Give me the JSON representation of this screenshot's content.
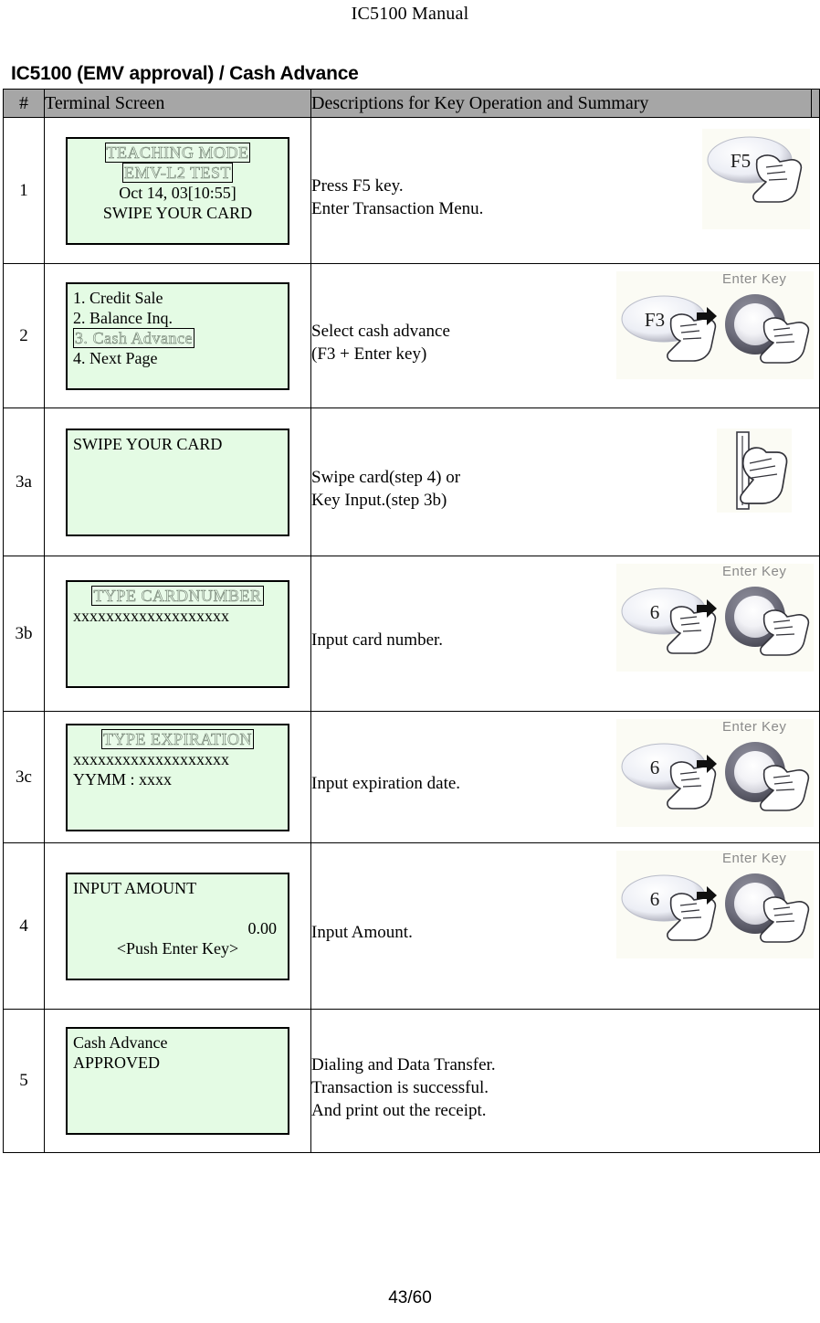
{
  "page": {
    "header_title": "IC5100 Manual",
    "section_title": "IC5100 (EMV approval) / Cash Advance",
    "footer": "43/60"
  },
  "table": {
    "columns": {
      "num": "#",
      "screen": "Terminal Screen",
      "description": "Descriptions for Key Operation and Summary"
    },
    "rows": [
      {
        "num": "1",
        "screen_lines": [
          {
            "text": "TEACHING MODE",
            "style": "reverse",
            "align": "center"
          },
          {
            "text": "EMV-L2 TEST",
            "style": "reverse",
            "align": "center"
          },
          {
            "text": "Oct 14, 03[10:55]",
            "style": "normal",
            "align": "center"
          },
          {
            "text": "SWIPE YOUR CARD",
            "style": "normal",
            "align": "center"
          }
        ],
        "description": "Press F5 key.\nEnter Transaction Menu.",
        "icon": "key-f5-press",
        "icon_key_label": "F5",
        "icon_enter_label": ""
      },
      {
        "num": "2",
        "screen_lines": [
          {
            "text": "1. Credit Sale",
            "style": "normal",
            "align": "left"
          },
          {
            "text": "2. Balance Inq.",
            "style": "normal",
            "align": "left"
          },
          {
            "text": "3. Cash Advance",
            "style": "reverse",
            "align": "left"
          },
          {
            "text": "4. Next Page",
            "style": "normal",
            "align": "left"
          }
        ],
        "description": "Select cash advance\n(F3 + Enter key)",
        "icon": "key-plus-enter",
        "icon_key_label": "F3",
        "icon_enter_label": "Enter Key"
      },
      {
        "num": "3a",
        "screen_lines": [
          {
            "text": "SWIPE YOUR CARD",
            "style": "normal",
            "align": "left"
          }
        ],
        "description": "Swipe card(step 4) or\nKey Input.(step 3b)",
        "icon": "card-swipe-hand",
        "icon_key_label": "",
        "icon_enter_label": ""
      },
      {
        "num": "3b",
        "screen_lines": [
          {
            "text": "TYPE CARDNUMBER",
            "style": "reverse",
            "align": "center"
          },
          {
            "text": "xxxxxxxxxxxxxxxxxxx",
            "style": "normal",
            "align": "left"
          }
        ],
        "description": "Input card number.",
        "icon": "key-plus-enter",
        "icon_key_label": "6",
        "icon_enter_label": "Enter Key"
      },
      {
        "num": "3c",
        "screen_lines": [
          {
            "text": "TYPE EXPIRATION",
            "style": "reverse",
            "align": "center"
          },
          {
            "text": "xxxxxxxxxxxxxxxxxxx",
            "style": "normal",
            "align": "left"
          },
          {
            "text": "YYMM : xxxx",
            "style": "normal",
            "align": "left"
          }
        ],
        "description": "Input expiration date.",
        "icon": "key-plus-enter",
        "icon_key_label": "6",
        "icon_enter_label": "Enter Key"
      },
      {
        "num": "4",
        "screen_lines": [
          {
            "text": "INPUT AMOUNT",
            "style": "normal",
            "align": "left"
          },
          {
            "text": "",
            "style": "normal",
            "align": "left"
          },
          {
            "text": "0.00",
            "style": "normal",
            "align": "right"
          },
          {
            "text": "<Push Enter Key>",
            "style": "normal",
            "align": "center"
          }
        ],
        "description": "Input Amount.",
        "icon": "key-plus-enter",
        "icon_key_label": "6",
        "icon_enter_label": "Enter Key"
      },
      {
        "num": "5",
        "screen_lines": [
          {
            "text": "Cash Advance",
            "style": "normal",
            "align": "left"
          },
          {
            "text": "APPROVED",
            "style": "normal",
            "align": "left"
          }
        ],
        "description": "Dialing and Data Transfer.\nTransaction is successful.\nAnd print out the receipt.",
        "icon": "none",
        "icon_key_label": "",
        "icon_enter_label": ""
      }
    ]
  },
  "colors": {
    "lcd_background": "#e4fbe4",
    "header_background": "#a6a6a6",
    "border": "#000000",
    "icon_background": "#fbfbf4"
  }
}
